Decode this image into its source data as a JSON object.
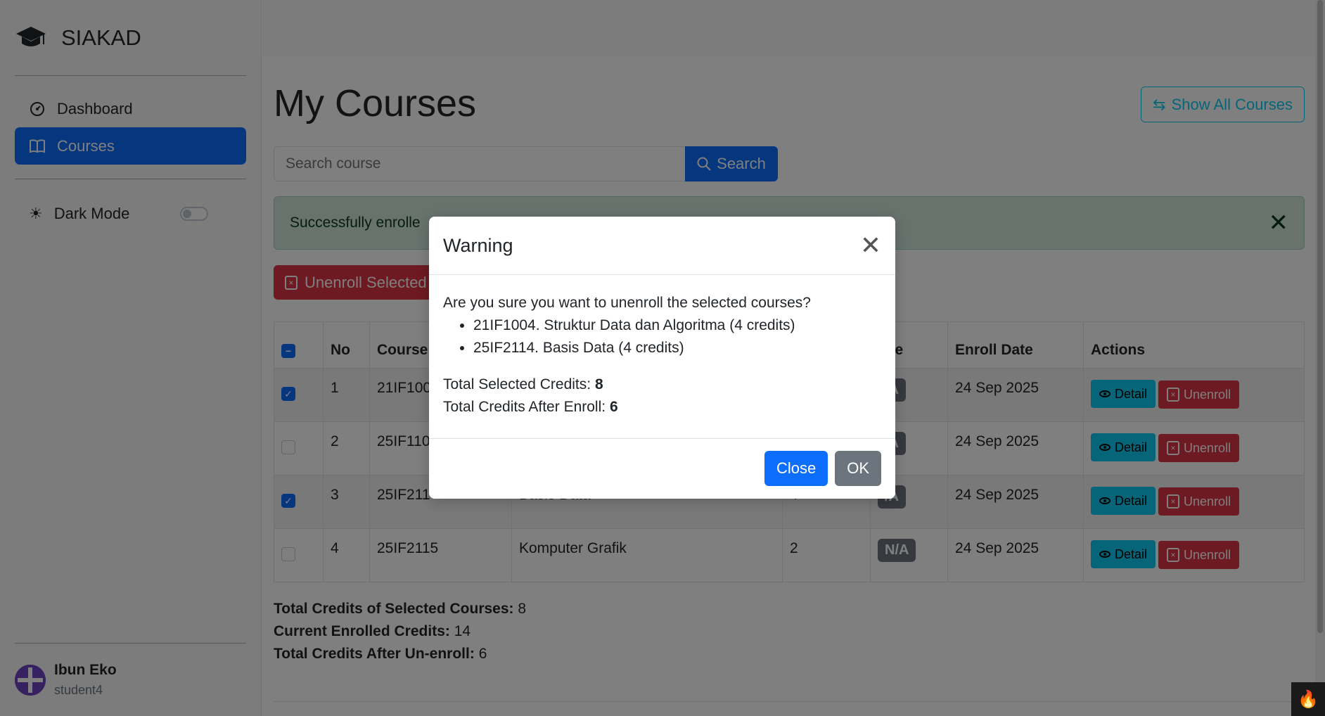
{
  "app": {
    "brand": "SIAKAD"
  },
  "sidebar": {
    "items": [
      {
        "label": "Dashboard",
        "icon": "speedometer-icon",
        "active": false
      },
      {
        "label": "Courses",
        "icon": "book-icon",
        "active": true
      }
    ],
    "dark_mode_label": "Dark Mode",
    "dark_mode_on": false,
    "user": {
      "name": "Ibun Eko",
      "username": "student4"
    }
  },
  "page": {
    "title": "My Courses",
    "show_all_label": "Show All Courses",
    "search_placeholder": "Search course",
    "search_label": "Search",
    "alert_text": "Successfully enrolle",
    "unenroll_selected_label": "Unenroll Selected"
  },
  "table": {
    "headers": [
      "No",
      "Course",
      "ade",
      "Enroll Date",
      "Actions"
    ],
    "detail_label": "Detail",
    "unenroll_label": "Unenroll",
    "rows": [
      {
        "checked": true,
        "no": "1",
        "code": "21IF100",
        "name": "",
        "credits": "",
        "grade": "/A",
        "date": "24 Sep 2025"
      },
      {
        "checked": false,
        "no": "2",
        "code": "25IF110",
        "name": "",
        "credits": "",
        "grade": "/A",
        "date": "24 Sep 2025"
      },
      {
        "checked": true,
        "no": "3",
        "code": "25IF211",
        "name": "Basis Data",
        "credits": "4",
        "grade": "/A",
        "date": "24 Sep 2025"
      },
      {
        "checked": false,
        "no": "4",
        "code": "25IF2115",
        "name": "Komputer Grafik",
        "credits": "2",
        "grade": "N/A",
        "date": "24 Sep 2025"
      }
    ]
  },
  "totals": {
    "selected_label": "Total Credits of Selected Courses:",
    "selected_value": "8",
    "enrolled_label": "Current Enrolled Credits:",
    "enrolled_value": "14",
    "after_label": "Total Credits After Un-enroll:",
    "after_value": "6"
  },
  "modal": {
    "title": "Warning",
    "question": "Are you sure you want to unenroll the selected courses?",
    "courses": [
      "21IF1004. Struktur Data dan Algoritma (4 credits)",
      "25IF2114. Basis Data (4 credits)"
    ],
    "total_selected_label": "Total Selected Credits:",
    "total_selected_value": "8",
    "total_after_label": "Total Credits After Enroll:",
    "total_after_value": "6",
    "close_label": "Close",
    "ok_label": "OK"
  },
  "colors": {
    "primary": "#0d6efd",
    "danger": "#dc3545",
    "info": "#0dcaf0",
    "success_bg": "#d1e7dd",
    "secondary": "#6c757d"
  }
}
